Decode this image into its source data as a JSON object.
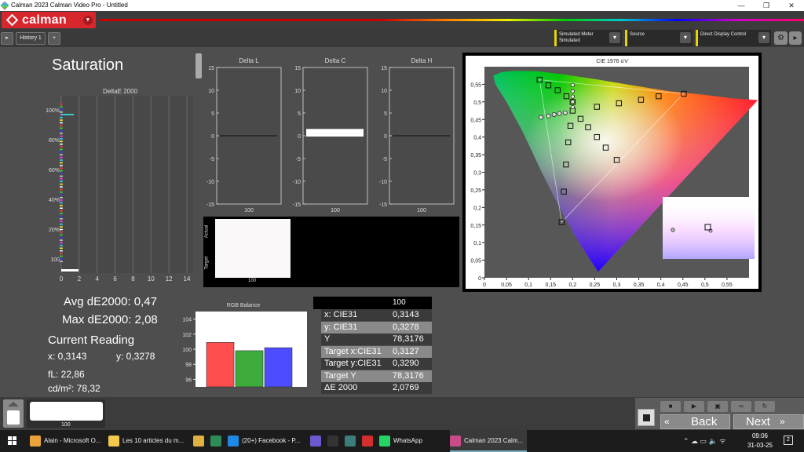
{
  "window": {
    "title": "Calman 2023 Calman Video Pro  -  Untitled",
    "minimize": "—",
    "maximize": "❐",
    "close": "✕"
  },
  "brand": {
    "name": "calman",
    "dropdown": "▾"
  },
  "toolbar": {
    "left_arrow": "▸",
    "history_tab": "History 1",
    "add_tab": "+",
    "meter": {
      "line1": "Simulated Meter",
      "line2": "Simulated"
    },
    "source": {
      "label": "Source"
    },
    "display": {
      "label": "Direct Display Control"
    },
    "dd": "▾",
    "gear": "⚙",
    "more": "▸"
  },
  "page": {
    "title": "Saturation",
    "avg": "Avg dE2000: 0,47",
    "max": "Max dE2000: 2,08",
    "current_reading_title": "Current Reading",
    "x_reading": "x: 0,3143",
    "y_reading": "y: 0,3278",
    "fl": "fL: 22,86",
    "cdm2": "cd/m²: 78,32"
  },
  "deltae_chart": {
    "title": "DeltaE 2000",
    "xticks": [
      "0",
      "2",
      "4",
      "6",
      "8",
      "10",
      "12",
      "14"
    ],
    "yticks": [
      "100%",
      "80%",
      "60%",
      "40%",
      "20%",
      "100"
    ]
  },
  "delta_charts": {
    "l": {
      "title": "Delta L"
    },
    "c": {
      "title": "Delta C"
    },
    "h": {
      "title": "Delta H"
    },
    "yticks": [
      "15",
      "10",
      "5",
      "0",
      "-5",
      "-10",
      "-15"
    ],
    "xlabel": "100"
  },
  "swatch": {
    "actual_label": "Actual",
    "target_label": "Target",
    "xlabel": "100"
  },
  "rgb_balance": {
    "title": "RGB Balance",
    "yticks": [
      "104",
      "102",
      "100",
      "98",
      "96"
    ]
  },
  "readings_table": {
    "header": "100",
    "rows": [
      {
        "key": "x: CIE31",
        "value": "0,3143"
      },
      {
        "key": "y: CIE31",
        "value": "0,3278"
      },
      {
        "key": "Y",
        "value": "78,3176"
      },
      {
        "key": "Target x:CIE31",
        "value": "0,3127"
      },
      {
        "key": "Target y:CIE31",
        "value": "0,3290"
      },
      {
        "key": "Target Y",
        "value": "78,3176"
      },
      {
        "key": "ΔE 2000",
        "value": "2,0769"
      }
    ]
  },
  "cie": {
    "title": "CIE 1976 u'v'",
    "xticks": [
      "0",
      "0,05",
      "0,1",
      "0,15",
      "0,2",
      "0,25",
      "0,3",
      "0,35",
      "0,4",
      "0,45",
      "0,5",
      "0,55"
    ],
    "yticks": [
      "0,55",
      "0,5",
      "0,45",
      "0,4",
      "0,35",
      "0,3",
      "0,25",
      "0,2",
      "0,15",
      "0,1",
      "0,05",
      "0"
    ]
  },
  "bottom": {
    "thumb_label": "100",
    "back": "Back",
    "next": "Next"
  },
  "taskbar": {
    "items": [
      {
        "label": "Alain - Microsoft O...",
        "color": "#e8a33a"
      },
      {
        "label": "Les 10 articles du m...",
        "color": "#f2c94c"
      },
      {
        "label": "",
        "color": "#e0b040"
      },
      {
        "label": "",
        "color": "#2e8b57"
      },
      {
        "label": "(20+) Facebook - P...",
        "color": "#1e88e5"
      },
      {
        "label": "",
        "color": "#6a5acd"
      },
      {
        "label": "",
        "color": "#333333"
      },
      {
        "label": "",
        "color": "#3a7d7a"
      },
      {
        "label": "",
        "color": "#d32f2f"
      },
      {
        "label": "WhatsApp",
        "color": "#25d366"
      },
      {
        "label": "Calman 2023 Calm...",
        "color": "#c94b8a"
      }
    ],
    "time": "09:06",
    "date": "31-03-25",
    "notif_count": "2"
  },
  "chart_data": [
    {
      "type": "bar",
      "title": "RGB Balance",
      "categories": [
        "R",
        "G",
        "B"
      ],
      "values": [
        100.9,
        99.8,
        100.2
      ],
      "ylim": [
        95,
        105
      ],
      "colors": [
        "#ff4d4d",
        "#3cab3c",
        "#4d4dff"
      ]
    },
    {
      "type": "bar",
      "title": "Delta C",
      "categories": [
        "100"
      ],
      "values": [
        0.6
      ],
      "ylim": [
        -15,
        15
      ]
    },
    {
      "type": "scatter",
      "title": "CIE 1976 u'v'",
      "xlim": [
        0,
        0.6
      ],
      "ylim": [
        0,
        0.6
      ],
      "series": [
        {
          "name": "targets",
          "points": [
            [
              0.452,
              0.523
            ],
            [
              0.395,
              0.516
            ],
            [
              0.355,
              0.506
            ],
            [
              0.305,
              0.496
            ],
            [
              0.255,
              0.486
            ],
            [
              0.2,
              0.475
            ],
            [
              0.125,
              0.563
            ],
            [
              0.145,
              0.547
            ],
            [
              0.166,
              0.533
            ],
            [
              0.186,
              0.516
            ],
            [
              0.2,
              0.5
            ],
            [
              0.175,
              0.158
            ],
            [
              0.18,
              0.245
            ],
            [
              0.185,
              0.322
            ],
            [
              0.19,
              0.385
            ],
            [
              0.195,
              0.432
            ],
            [
              0.3,
              0.335
            ],
            [
              0.275,
              0.37
            ],
            [
              0.255,
              0.4
            ],
            [
              0.235,
              0.428
            ],
            [
              0.218,
              0.452
            ],
            [
              0.2,
              0.548
            ],
            [
              0.2,
              0.53
            ],
            [
              0.2,
              0.515
            ],
            [
              0.2,
              0.5
            ],
            [
              0.2,
              0.485
            ],
            [
              0.128,
              0.456
            ],
            [
              0.145,
              0.46
            ],
            [
              0.158,
              0.464
            ],
            [
              0.17,
              0.467
            ],
            [
              0.183,
              0.469
            ]
          ]
        }
      ]
    }
  ]
}
